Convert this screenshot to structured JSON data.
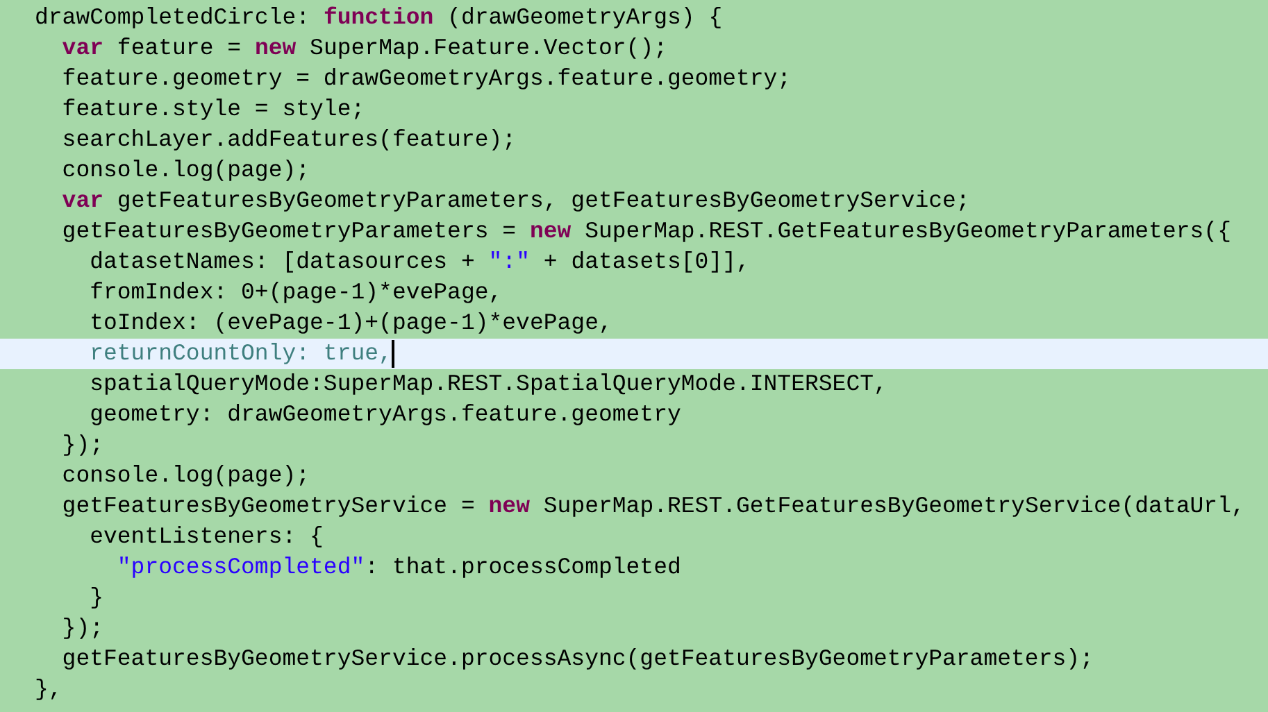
{
  "editor": {
    "lines": [
      {
        "current": false,
        "tokens": [
          {
            "kind": "plain",
            "text": "drawCompletedCircle: "
          },
          {
            "kind": "keyword",
            "text": "function"
          },
          {
            "kind": "plain",
            "text": " (drawGeometryArgs) {"
          }
        ]
      },
      {
        "current": false,
        "tokens": [
          {
            "kind": "keyword",
            "text": "  var"
          },
          {
            "kind": "plain",
            "text": " feature = "
          },
          {
            "kind": "keyword",
            "text": "new"
          },
          {
            "kind": "plain",
            "text": " SuperMap.Feature.Vector();"
          }
        ]
      },
      {
        "current": false,
        "tokens": [
          {
            "kind": "plain",
            "text": "  feature.geometry = drawGeometryArgs.feature.geometry;"
          }
        ]
      },
      {
        "current": false,
        "tokens": [
          {
            "kind": "plain",
            "text": "  feature.style = style;"
          }
        ]
      },
      {
        "current": false,
        "tokens": [
          {
            "kind": "plain",
            "text": "  searchLayer.addFeatures(feature);"
          }
        ]
      },
      {
        "current": false,
        "tokens": [
          {
            "kind": "plain",
            "text": "  console.log(page);"
          }
        ]
      },
      {
        "current": false,
        "tokens": [
          {
            "kind": "keyword",
            "text": "  var"
          },
          {
            "kind": "plain",
            "text": " getFeaturesByGeometryParameters, getFeaturesByGeometryService;"
          }
        ]
      },
      {
        "current": false,
        "tokens": [
          {
            "kind": "plain",
            "text": "  getFeaturesByGeometryParameters = "
          },
          {
            "kind": "keyword",
            "text": "new"
          },
          {
            "kind": "plain",
            "text": " SuperMap.REST.GetFeaturesByGeometryParameters({"
          }
        ]
      },
      {
        "current": false,
        "tokens": [
          {
            "kind": "plain",
            "text": "    datasetNames: [datasources + "
          },
          {
            "kind": "string",
            "text": "\":\""
          },
          {
            "kind": "plain",
            "text": " + datasets[0]],"
          }
        ]
      },
      {
        "current": false,
        "tokens": [
          {
            "kind": "plain",
            "text": "    fromIndex: 0+(page-1)*evePage,"
          }
        ]
      },
      {
        "current": false,
        "tokens": [
          {
            "kind": "plain",
            "text": "    toIndex: (evePage-1)+(page-1)*evePage,"
          }
        ]
      },
      {
        "current": true,
        "tokens": [
          {
            "kind": "muted",
            "text": "    returnCountOnly: true,"
          }
        ]
      },
      {
        "current": false,
        "tokens": [
          {
            "kind": "plain",
            "text": "    spatialQueryMode:SuperMap.REST.SpatialQueryMode.INTERSECT,"
          }
        ]
      },
      {
        "current": false,
        "tokens": [
          {
            "kind": "plain",
            "text": "    geometry: drawGeometryArgs.feature.geometry"
          }
        ]
      },
      {
        "current": false,
        "tokens": [
          {
            "kind": "plain",
            "text": "  });"
          }
        ]
      },
      {
        "current": false,
        "tokens": [
          {
            "kind": "plain",
            "text": "  console.log(page);"
          }
        ]
      },
      {
        "current": false,
        "tokens": [
          {
            "kind": "plain",
            "text": "  getFeaturesByGeometryService = "
          },
          {
            "kind": "keyword",
            "text": "new"
          },
          {
            "kind": "plain",
            "text": " SuperMap.REST.GetFeaturesByGeometryService(dataUrl,"
          }
        ]
      },
      {
        "current": false,
        "tokens": [
          {
            "kind": "plain",
            "text": "    eventListeners: {"
          }
        ]
      },
      {
        "current": false,
        "tokens": [
          {
            "kind": "string",
            "text": "      \"processCompleted\""
          },
          {
            "kind": "plain",
            "text": ": that.processCompleted"
          }
        ]
      },
      {
        "current": false,
        "tokens": [
          {
            "kind": "plain",
            "text": "    }"
          }
        ]
      },
      {
        "current": false,
        "tokens": [
          {
            "kind": "plain",
            "text": "  });"
          }
        ]
      },
      {
        "current": false,
        "tokens": [
          {
            "kind": "plain",
            "text": "  getFeaturesByGeometryService.processAsync(getFeaturesByGeometryParameters);"
          }
        ]
      },
      {
        "current": false,
        "tokens": [
          {
            "kind": "plain",
            "text": "},"
          }
        ]
      }
    ]
  }
}
